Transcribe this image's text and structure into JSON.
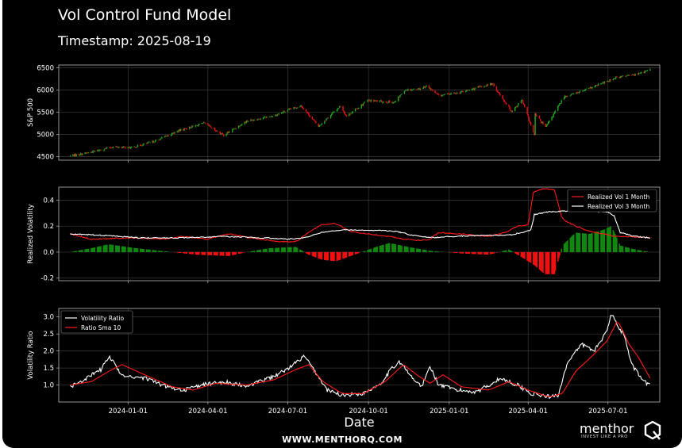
{
  "header": {
    "title": "Vol Control Fund Model",
    "subtitle": "Timestamp: 2025-08-19"
  },
  "footer": {
    "website": "WWW.MENTHORQ.COM",
    "logo_word": "menthor",
    "logo_letter": "Q",
    "logo_tagline": "INVEST LIKE A PRO"
  },
  "chart_data": [
    {
      "type": "candlestick",
      "ylabel": "S&P 500",
      "xlabel": "",
      "ylim": [
        4420,
        6560
      ],
      "xlim": [
        "2023-10-14",
        "2025-08-29"
      ],
      "yticks": [
        4500,
        5000,
        5500,
        6000,
        6500
      ],
      "grid": true,
      "up_color": "#22aa22",
      "down_color": "#ee1111",
      "close_path": [
        [
          "2023-10-27",
          4520
        ],
        [
          "2023-11-15",
          4580
        ],
        [
          "2023-12-15",
          4720
        ],
        [
          "2024-01-05",
          4700
        ],
        [
          "2024-02-01",
          4850
        ],
        [
          "2024-03-01",
          5100
        ],
        [
          "2024-03-28",
          5250
        ],
        [
          "2024-04-19",
          4980
        ],
        [
          "2024-05-15",
          5300
        ],
        [
          "2024-06-15",
          5420
        ],
        [
          "2024-07-16",
          5650
        ],
        [
          "2024-08-05",
          5180
        ],
        [
          "2024-08-30",
          5640
        ],
        [
          "2024-09-06",
          5410
        ],
        [
          "2024-09-30",
          5760
        ],
        [
          "2024-10-31",
          5720
        ],
        [
          "2024-11-11",
          6000
        ],
        [
          "2024-11-30",
          6030
        ],
        [
          "2024-12-06",
          6090
        ],
        [
          "2024-12-20",
          5870
        ],
        [
          "2025-01-15",
          5950
        ],
        [
          "2025-02-19",
          6140
        ],
        [
          "2025-03-13",
          5520
        ],
        [
          "2025-03-25",
          5770
        ],
        [
          "2025-04-08",
          4980
        ],
        [
          "2025-04-09",
          5450
        ],
        [
          "2025-04-21",
          5160
        ],
        [
          "2025-05-12",
          5850
        ],
        [
          "2025-06-06",
          6000
        ],
        [
          "2025-07-10",
          6280
        ],
        [
          "2025-07-31",
          6340
        ],
        [
          "2025-08-18",
          6450
        ]
      ]
    },
    {
      "type": "line",
      "ylabel": "Realized Volatility",
      "xlabel": "",
      "ylim": [
        -0.22,
        0.5
      ],
      "xlim": [
        "2023-10-14",
        "2025-08-29"
      ],
      "yticks": [
        -0.2,
        0.0,
        0.2,
        0.4
      ],
      "grid": true,
      "legend_position": "top-right",
      "series": [
        {
          "name": "Realized Vol 1 Month",
          "color": "#ff1a1a",
          "points": [
            [
              "2023-10-27",
              0.14
            ],
            [
              "2023-11-20",
              0.1
            ],
            [
              "2024-01-01",
              0.11
            ],
            [
              "2024-02-10",
              0.1
            ],
            [
              "2024-03-01",
              0.12
            ],
            [
              "2024-04-01",
              0.1
            ],
            [
              "2024-04-25",
              0.14
            ],
            [
              "2024-05-20",
              0.11
            ],
            [
              "2024-06-20",
              0.08
            ],
            [
              "2024-07-10",
              0.08
            ],
            [
              "2024-07-25",
              0.15
            ],
            [
              "2024-08-08",
              0.21
            ],
            [
              "2024-08-25",
              0.22
            ],
            [
              "2024-09-10",
              0.16
            ],
            [
              "2024-10-01",
              0.14
            ],
            [
              "2024-10-25",
              0.12
            ],
            [
              "2024-11-10",
              0.1
            ],
            [
              "2024-11-30",
              0.09
            ],
            [
              "2024-12-10",
              0.1
            ],
            [
              "2024-12-20",
              0.15
            ],
            [
              "2025-01-15",
              0.14
            ],
            [
              "2025-02-15",
              0.12
            ],
            [
              "2025-03-05",
              0.15
            ],
            [
              "2025-03-20",
              0.2
            ],
            [
              "2025-04-01",
              0.21
            ],
            [
              "2025-04-07",
              0.46
            ],
            [
              "2025-04-20",
              0.49
            ],
            [
              "2025-05-01",
              0.48
            ],
            [
              "2025-05-10",
              0.25
            ],
            [
              "2025-05-25",
              0.2
            ],
            [
              "2025-06-10",
              0.16
            ],
            [
              "2025-06-25",
              0.14
            ],
            [
              "2025-07-10",
              0.12
            ],
            [
              "2025-07-25",
              0.12
            ],
            [
              "2025-08-18",
              0.11
            ]
          ]
        },
        {
          "name": "Realized Vol 3 Month",
          "color": "#ffffff",
          "points": [
            [
              "2023-10-27",
              0.14
            ],
            [
              "2023-12-01",
              0.13
            ],
            [
              "2024-01-15",
              0.11
            ],
            [
              "2024-03-01",
              0.11
            ],
            [
              "2024-04-20",
              0.12
            ],
            [
              "2024-06-01",
              0.11
            ],
            [
              "2024-07-01",
              0.1
            ],
            [
              "2024-07-20",
              0.11
            ],
            [
              "2024-08-08",
              0.15
            ],
            [
              "2024-09-01",
              0.17
            ],
            [
              "2024-10-01",
              0.17
            ],
            [
              "2024-11-01",
              0.16
            ],
            [
              "2024-11-20",
              0.13
            ],
            [
              "2024-12-15",
              0.11
            ],
            [
              "2025-01-01",
              0.12
            ],
            [
              "2025-02-15",
              0.13
            ],
            [
              "2025-03-10",
              0.13
            ],
            [
              "2025-03-25",
              0.15
            ],
            [
              "2025-04-05",
              0.17
            ],
            [
              "2025-04-08",
              0.29
            ],
            [
              "2025-04-25",
              0.31
            ],
            [
              "2025-06-01",
              0.32
            ],
            [
              "2025-07-01",
              0.31
            ],
            [
              "2025-07-08",
              0.28
            ],
            [
              "2025-07-15",
              0.15
            ],
            [
              "2025-08-01",
              0.12
            ],
            [
              "2025-08-18",
              0.11
            ]
          ]
        }
      ],
      "bar_series": {
        "colors": {
          "positive": "#118811",
          "negative": "#ee1111"
        },
        "points": [
          [
            "2023-10-27",
            0.0
          ],
          [
            "2023-11-20",
            0.03
          ],
          [
            "2023-12-10",
            0.06
          ],
          [
            "2024-01-10",
            0.03
          ],
          [
            "2024-02-20",
            0.0
          ],
          [
            "2024-03-20",
            -0.02
          ],
          [
            "2024-04-25",
            -0.03
          ],
          [
            "2024-05-15",
            0.0
          ],
          [
            "2024-06-10",
            0.03
          ],
          [
            "2024-07-10",
            0.04
          ],
          [
            "2024-07-25",
            -0.02
          ],
          [
            "2024-08-10",
            -0.06
          ],
          [
            "2024-08-25",
            -0.07
          ],
          [
            "2024-09-15",
            -0.02
          ],
          [
            "2024-10-10",
            0.04
          ],
          [
            "2024-10-25",
            0.07
          ],
          [
            "2024-11-15",
            0.04
          ],
          [
            "2024-12-10",
            0.01
          ],
          [
            "2025-01-15",
            -0.01
          ],
          [
            "2025-02-15",
            -0.02
          ],
          [
            "2025-03-10",
            0.02
          ],
          [
            "2025-03-25",
            -0.04
          ],
          [
            "2025-04-08",
            -0.1
          ],
          [
            "2025-04-20",
            -0.17
          ],
          [
            "2025-05-01",
            -0.17
          ],
          [
            "2025-05-10",
            0.05
          ],
          [
            "2025-05-25",
            0.15
          ],
          [
            "2025-06-10",
            0.14
          ],
          [
            "2025-06-25",
            0.17
          ],
          [
            "2025-07-05",
            0.2
          ],
          [
            "2025-07-15",
            0.05
          ],
          [
            "2025-08-01",
            0.02
          ],
          [
            "2025-08-18",
            0.0
          ]
        ]
      }
    },
    {
      "type": "line",
      "ylabel": "Volatility Ratio",
      "xlabel": "Date",
      "ylim": [
        0.5,
        3.25
      ],
      "xlim": [
        "2023-10-14",
        "2025-08-29"
      ],
      "yticks": [
        1.0,
        1.5,
        2.0,
        2.5,
        3.0
      ],
      "xticks": [
        "2024-01-01",
        "2024-04-01",
        "2024-07-01",
        "2024-10-01",
        "2025-01-01",
        "2025-04-01",
        "2025-07-01"
      ],
      "grid": true,
      "legend_position": "top-left",
      "series": [
        {
          "name": "Volatility Ratio",
          "color": "#ffffff",
          "points": [
            [
              "2023-10-27",
              0.95
            ],
            [
              "2023-11-15",
              1.2
            ],
            [
              "2023-12-01",
              1.45
            ],
            [
              "2023-12-10",
              1.85
            ],
            [
              "2023-12-25",
              1.3
            ],
            [
              "2024-01-20",
              1.2
            ],
            [
              "2024-02-15",
              0.95
            ],
            [
              "2024-03-05",
              0.85
            ],
            [
              "2024-03-25",
              1.0
            ],
            [
              "2024-04-20",
              1.1
            ],
            [
              "2024-05-15",
              0.95
            ],
            [
              "2024-06-10",
              1.2
            ],
            [
              "2024-06-30",
              1.45
            ],
            [
              "2024-07-20",
              1.85
            ],
            [
              "2024-08-01",
              1.4
            ],
            [
              "2024-08-15",
              0.85
            ],
            [
              "2024-09-01",
              0.7
            ],
            [
              "2024-09-25",
              0.75
            ],
            [
              "2024-10-15",
              1.05
            ],
            [
              "2024-10-25",
              1.4
            ],
            [
              "2024-11-05",
              1.7
            ],
            [
              "2024-11-20",
              1.2
            ],
            [
              "2024-12-01",
              0.95
            ],
            [
              "2024-12-10",
              1.55
            ],
            [
              "2024-12-20",
              1.0
            ],
            [
              "2025-01-10",
              0.85
            ],
            [
              "2025-02-01",
              0.8
            ],
            [
              "2025-03-01",
              1.2
            ],
            [
              "2025-03-20",
              1.0
            ],
            [
              "2025-04-05",
              0.75
            ],
            [
              "2025-04-25",
              0.65
            ],
            [
              "2025-05-05",
              0.7
            ],
            [
              "2025-05-15",
              1.6
            ],
            [
              "2025-06-01",
              2.2
            ],
            [
              "2025-06-15",
              2.0
            ],
            [
              "2025-06-28",
              2.5
            ],
            [
              "2025-07-05",
              3.1
            ],
            [
              "2025-07-20",
              2.4
            ],
            [
              "2025-07-28",
              1.6
            ],
            [
              "2025-08-10",
              1.1
            ],
            [
              "2025-08-18",
              1.0
            ]
          ]
        },
        {
          "name": "Ratio Sma 10",
          "color": "#ff1a1a",
          "points": [
            [
              "2023-10-27",
              1.0
            ],
            [
              "2023-11-20",
              1.1
            ],
            [
              "2023-12-10",
              1.4
            ],
            [
              "2023-12-25",
              1.6
            ],
            [
              "2024-01-20",
              1.3
            ],
            [
              "2024-02-20",
              0.95
            ],
            [
              "2024-03-15",
              0.85
            ],
            [
              "2024-04-10",
              1.05
            ],
            [
              "2024-05-15",
              1.0
            ],
            [
              "2024-06-15",
              1.15
            ],
            [
              "2024-07-10",
              1.45
            ],
            [
              "2024-07-25",
              1.6
            ],
            [
              "2024-08-10",
              1.1
            ],
            [
              "2024-09-01",
              0.75
            ],
            [
              "2024-09-25",
              0.75
            ],
            [
              "2024-10-20",
              1.1
            ],
            [
              "2024-11-10",
              1.6
            ],
            [
              "2024-11-25",
              1.3
            ],
            [
              "2024-12-10",
              1.05
            ],
            [
              "2024-12-25",
              1.3
            ],
            [
              "2025-01-15",
              0.95
            ],
            [
              "2025-02-15",
              0.85
            ],
            [
              "2025-03-10",
              1.1
            ],
            [
              "2025-04-01",
              0.85
            ],
            [
              "2025-04-25",
              0.65
            ],
            [
              "2025-05-10",
              0.75
            ],
            [
              "2025-05-25",
              1.4
            ],
            [
              "2025-06-15",
              1.9
            ],
            [
              "2025-06-30",
              2.3
            ],
            [
              "2025-07-12",
              2.9
            ],
            [
              "2025-07-25",
              2.2
            ],
            [
              "2025-08-05",
              1.8
            ],
            [
              "2025-08-18",
              1.2
            ]
          ]
        }
      ]
    }
  ]
}
